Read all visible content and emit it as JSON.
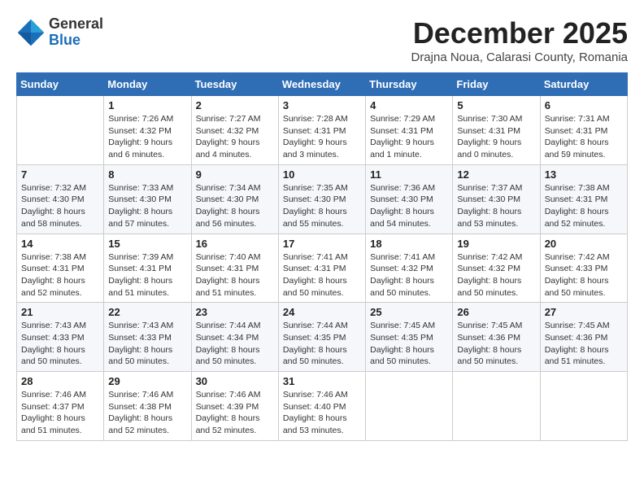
{
  "header": {
    "logo": {
      "line1": "General",
      "line2": "Blue"
    },
    "title": "December 2025",
    "location": "Drajna Noua, Calarasi County, Romania"
  },
  "calendar": {
    "days_of_week": [
      "Sunday",
      "Monday",
      "Tuesday",
      "Wednesday",
      "Thursday",
      "Friday",
      "Saturday"
    ],
    "weeks": [
      [
        {
          "day": "",
          "content": ""
        },
        {
          "day": "1",
          "content": "Sunrise: 7:26 AM\nSunset: 4:32 PM\nDaylight: 9 hours\nand 6 minutes."
        },
        {
          "day": "2",
          "content": "Sunrise: 7:27 AM\nSunset: 4:32 PM\nDaylight: 9 hours\nand 4 minutes."
        },
        {
          "day": "3",
          "content": "Sunrise: 7:28 AM\nSunset: 4:31 PM\nDaylight: 9 hours\nand 3 minutes."
        },
        {
          "day": "4",
          "content": "Sunrise: 7:29 AM\nSunset: 4:31 PM\nDaylight: 9 hours\nand 1 minute."
        },
        {
          "day": "5",
          "content": "Sunrise: 7:30 AM\nSunset: 4:31 PM\nDaylight: 9 hours\nand 0 minutes."
        },
        {
          "day": "6",
          "content": "Sunrise: 7:31 AM\nSunset: 4:31 PM\nDaylight: 8 hours\nand 59 minutes."
        }
      ],
      [
        {
          "day": "7",
          "content": "Sunrise: 7:32 AM\nSunset: 4:30 PM\nDaylight: 8 hours\nand 58 minutes."
        },
        {
          "day": "8",
          "content": "Sunrise: 7:33 AM\nSunset: 4:30 PM\nDaylight: 8 hours\nand 57 minutes."
        },
        {
          "day": "9",
          "content": "Sunrise: 7:34 AM\nSunset: 4:30 PM\nDaylight: 8 hours\nand 56 minutes."
        },
        {
          "day": "10",
          "content": "Sunrise: 7:35 AM\nSunset: 4:30 PM\nDaylight: 8 hours\nand 55 minutes."
        },
        {
          "day": "11",
          "content": "Sunrise: 7:36 AM\nSunset: 4:30 PM\nDaylight: 8 hours\nand 54 minutes."
        },
        {
          "day": "12",
          "content": "Sunrise: 7:37 AM\nSunset: 4:30 PM\nDaylight: 8 hours\nand 53 minutes."
        },
        {
          "day": "13",
          "content": "Sunrise: 7:38 AM\nSunset: 4:31 PM\nDaylight: 8 hours\nand 52 minutes."
        }
      ],
      [
        {
          "day": "14",
          "content": "Sunrise: 7:38 AM\nSunset: 4:31 PM\nDaylight: 8 hours\nand 52 minutes."
        },
        {
          "day": "15",
          "content": "Sunrise: 7:39 AM\nSunset: 4:31 PM\nDaylight: 8 hours\nand 51 minutes."
        },
        {
          "day": "16",
          "content": "Sunrise: 7:40 AM\nSunset: 4:31 PM\nDaylight: 8 hours\nand 51 minutes."
        },
        {
          "day": "17",
          "content": "Sunrise: 7:41 AM\nSunset: 4:31 PM\nDaylight: 8 hours\nand 50 minutes."
        },
        {
          "day": "18",
          "content": "Sunrise: 7:41 AM\nSunset: 4:32 PM\nDaylight: 8 hours\nand 50 minutes."
        },
        {
          "day": "19",
          "content": "Sunrise: 7:42 AM\nSunset: 4:32 PM\nDaylight: 8 hours\nand 50 minutes."
        },
        {
          "day": "20",
          "content": "Sunrise: 7:42 AM\nSunset: 4:33 PM\nDaylight: 8 hours\nand 50 minutes."
        }
      ],
      [
        {
          "day": "21",
          "content": "Sunrise: 7:43 AM\nSunset: 4:33 PM\nDaylight: 8 hours\nand 50 minutes."
        },
        {
          "day": "22",
          "content": "Sunrise: 7:43 AM\nSunset: 4:33 PM\nDaylight: 8 hours\nand 50 minutes."
        },
        {
          "day": "23",
          "content": "Sunrise: 7:44 AM\nSunset: 4:34 PM\nDaylight: 8 hours\nand 50 minutes."
        },
        {
          "day": "24",
          "content": "Sunrise: 7:44 AM\nSunset: 4:35 PM\nDaylight: 8 hours\nand 50 minutes."
        },
        {
          "day": "25",
          "content": "Sunrise: 7:45 AM\nSunset: 4:35 PM\nDaylight: 8 hours\nand 50 minutes."
        },
        {
          "day": "26",
          "content": "Sunrise: 7:45 AM\nSunset: 4:36 PM\nDaylight: 8 hours\nand 50 minutes."
        },
        {
          "day": "27",
          "content": "Sunrise: 7:45 AM\nSunset: 4:36 PM\nDaylight: 8 hours\nand 51 minutes."
        }
      ],
      [
        {
          "day": "28",
          "content": "Sunrise: 7:46 AM\nSunset: 4:37 PM\nDaylight: 8 hours\nand 51 minutes."
        },
        {
          "day": "29",
          "content": "Sunrise: 7:46 AM\nSunset: 4:38 PM\nDaylight: 8 hours\nand 52 minutes."
        },
        {
          "day": "30",
          "content": "Sunrise: 7:46 AM\nSunset: 4:39 PM\nDaylight: 8 hours\nand 52 minutes."
        },
        {
          "day": "31",
          "content": "Sunrise: 7:46 AM\nSunset: 4:40 PM\nDaylight: 8 hours\nand 53 minutes."
        },
        {
          "day": "",
          "content": ""
        },
        {
          "day": "",
          "content": ""
        },
        {
          "day": "",
          "content": ""
        }
      ]
    ]
  }
}
